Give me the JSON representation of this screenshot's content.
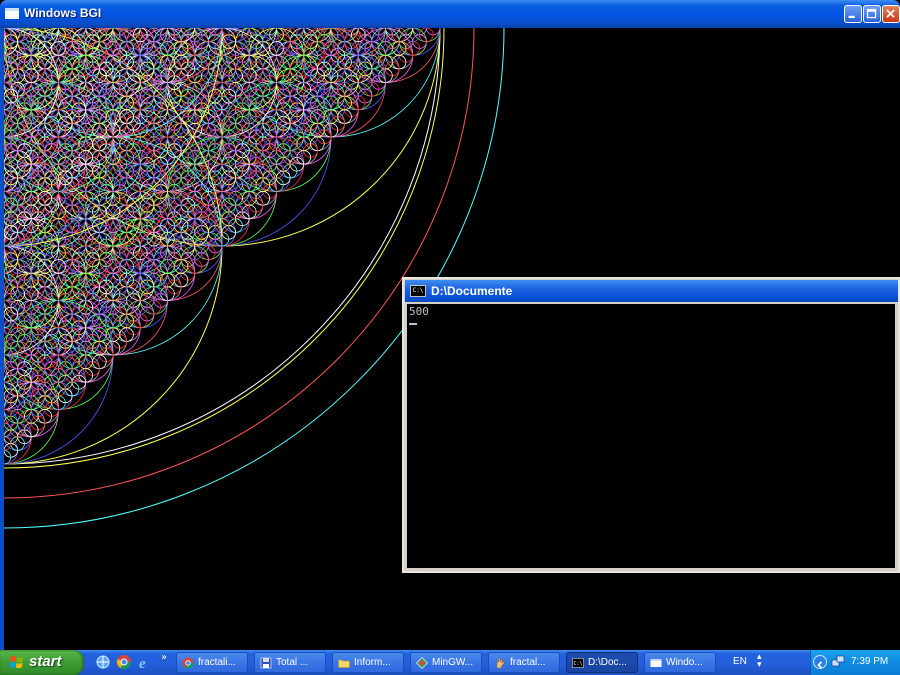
{
  "bgi_window": {
    "title": "Windows BGI",
    "title_icon": "window-icon",
    "controls": [
      "minimize",
      "maximize",
      "close"
    ]
  },
  "console_window": {
    "title": "D:\\Documente",
    "icon_text": "C:\\",
    "output": "500"
  },
  "taskbar": {
    "start_label": "start",
    "quick_launch": [
      "ie-globe-icon",
      "chrome-icon",
      "ie-icon"
    ],
    "more_label": "»",
    "tasks": [
      {
        "label": "fractali...",
        "icon": "chrome-icon",
        "active": false
      },
      {
        "label": "Total ...",
        "icon": "floppy-icon",
        "active": false
      },
      {
        "label": "Inform...",
        "icon": "folder-icon",
        "active": false
      },
      {
        "label": "MinGW...",
        "icon": "mingw-icon",
        "active": false
      },
      {
        "label": "fractal...",
        "icon": "hand-icon",
        "active": false
      },
      {
        "label": "D:\\Doc...",
        "icon": "console-icon",
        "active": true
      },
      {
        "label": "Windo...",
        "icon": "window-icon",
        "active": false
      }
    ],
    "language": "EN",
    "clock": "7:39 PM"
  },
  "colors": {
    "fractal": [
      "#ffffff",
      "#ffff55",
      "#55ffff",
      "#ff5555",
      "#5555ff",
      "#55ff55",
      "#ff55ff",
      "#aaaaaa",
      "#ff3030",
      "#6060ff"
    ]
  }
}
